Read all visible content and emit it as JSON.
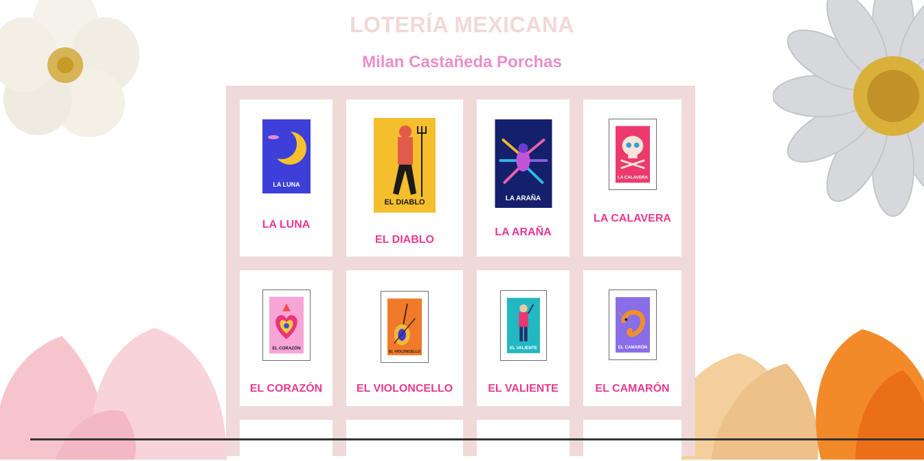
{
  "header": {
    "title": "LOTERÍA MEXICANA",
    "author": "Milan Castañeda Porchas"
  },
  "colors": {
    "board": "#f0d9d9",
    "label": "#e8398f",
    "title": "#f2d8d8",
    "subtitle": "#e98fc9"
  },
  "cards": [
    {
      "label": "LA LUNA",
      "art_text": "LA LUNA",
      "icon": "moon-card-icon"
    },
    {
      "label": "EL DIABLO",
      "art_text": "EL DIABLO",
      "icon": "devil-card-icon"
    },
    {
      "label": "LA ARAÑA",
      "art_text": "LA ARAÑA",
      "icon": "spider-card-icon"
    },
    {
      "label": "LA CALAVERA",
      "art_text": "LA CALAVERA",
      "icon": "skull-card-icon"
    },
    {
      "label": "EL CORAZÓN",
      "art_text": "EL CORAZÓN",
      "icon": "heart-card-icon"
    },
    {
      "label": "EL VIOLONCELLO",
      "art_text": "EL VIOLONCELLO",
      "icon": "cello-card-icon"
    },
    {
      "label": "EL VALIENTE",
      "art_text": "EL VALIENTE",
      "icon": "brave-man-card-icon"
    },
    {
      "label": "EL CAMARÓN",
      "art_text": "EL CAMARÓN",
      "icon": "shrimp-card-icon"
    }
  ]
}
